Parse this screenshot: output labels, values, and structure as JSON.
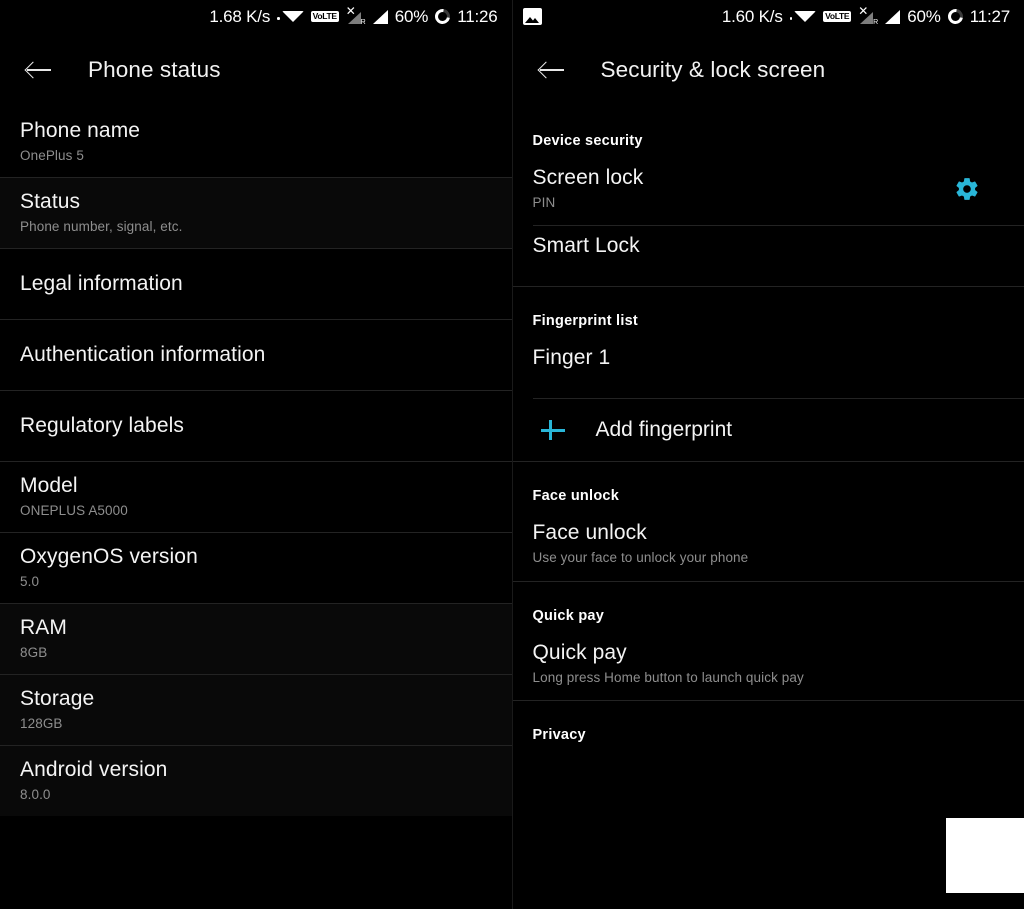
{
  "accent_color": "#29b6d8",
  "background_color": "#000000",
  "divider_color": "#232323",
  "left_screen": {
    "status_bar": {
      "net_speed": "1.68 K/s",
      "wifi_icon": "wifi-icon",
      "volte_label": "VoLTE",
      "no_service_icon": "signal-no-service-icon",
      "roaming_label": "R",
      "signal_icon": "signal-bars-icon",
      "battery_percent": "60%",
      "battery_icon": "battery-circle-icon",
      "clock": "11:26"
    },
    "app_bar": {
      "back_icon": "back-arrow-icon",
      "title": "Phone status"
    },
    "items": [
      {
        "title": "Phone name",
        "subtitle": "OnePlus 5"
      },
      {
        "title": "Status",
        "subtitle": "Phone number, signal, etc."
      },
      {
        "title": "Legal information",
        "subtitle": ""
      },
      {
        "title": "Authentication information",
        "subtitle": ""
      },
      {
        "title": "Regulatory labels",
        "subtitle": ""
      },
      {
        "title": "Model",
        "subtitle": "ONEPLUS A5000"
      },
      {
        "title": "OxygenOS version",
        "subtitle": "5.0"
      },
      {
        "title": "RAM",
        "subtitle": "8GB"
      },
      {
        "title": "Storage",
        "subtitle": "128GB"
      },
      {
        "title": "Android version",
        "subtitle": "8.0.0"
      }
    ]
  },
  "right_screen": {
    "status_bar": {
      "notification_icon": "image-notification-icon",
      "net_speed": "1.60 K/s",
      "wifi_icon": "wifi-icon",
      "volte_label": "VoLTE",
      "no_service_icon": "signal-no-service-icon",
      "roaming_label": "R",
      "signal_icon": "signal-bars-icon",
      "battery_percent": "60%",
      "battery_icon": "battery-circle-icon",
      "clock": "11:27"
    },
    "app_bar": {
      "back_icon": "back-arrow-icon",
      "title": "Security & lock screen"
    },
    "sections": [
      {
        "header": "Device security",
        "items": [
          {
            "title": "Screen lock",
            "subtitle": "PIN",
            "trailing_icon": "gear-icon"
          },
          {
            "title": "Smart Lock",
            "subtitle": ""
          }
        ]
      },
      {
        "header": "Fingerprint list",
        "items": [
          {
            "title": "Finger 1",
            "subtitle": ""
          }
        ],
        "add_action": {
          "icon": "plus-icon",
          "label": "Add fingerprint"
        }
      },
      {
        "header": "Face unlock",
        "items": [
          {
            "title": "Face unlock",
            "subtitle": "Use your face to unlock your phone"
          }
        ]
      },
      {
        "header": "Quick pay",
        "items": [
          {
            "title": "Quick pay",
            "subtitle": "Long press Home button to launch quick pay"
          }
        ]
      },
      {
        "header": "Privacy",
        "items": []
      }
    ]
  }
}
